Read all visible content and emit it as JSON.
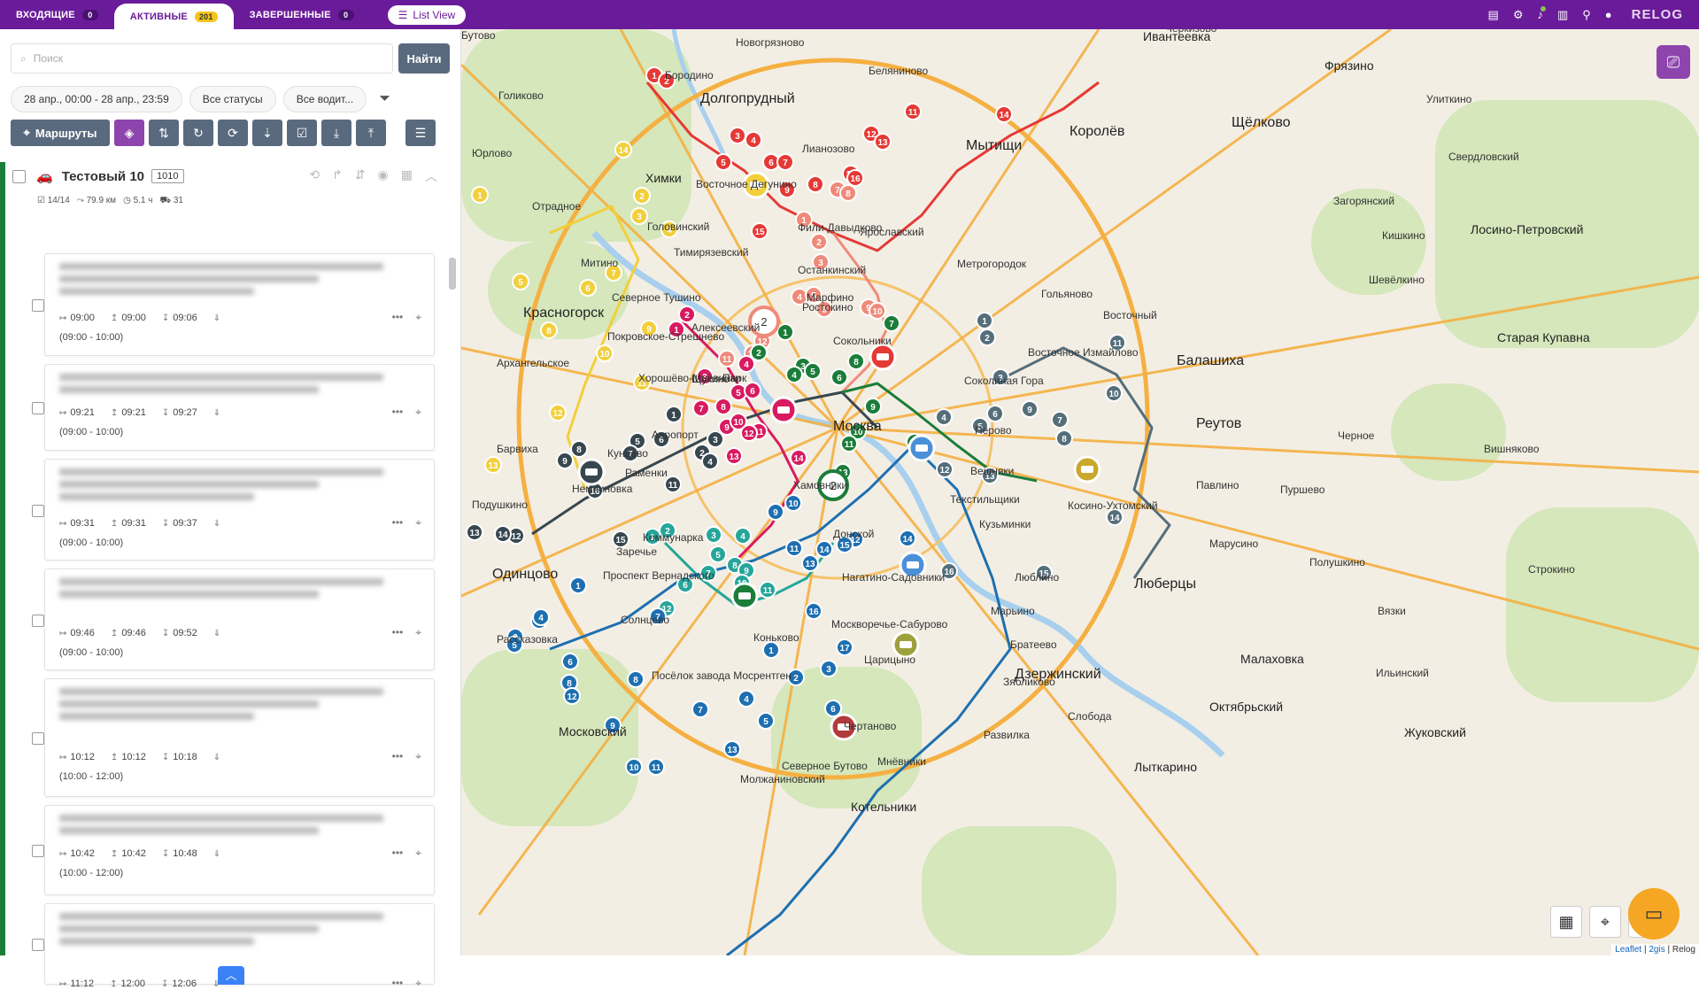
{
  "tabs": [
    {
      "label": "ВХОДЯЩИЕ",
      "count": "0"
    },
    {
      "label": "АКТИВНЫЕ",
      "count": "201"
    },
    {
      "label": "ЗАВЕРШЕННЫЕ",
      "count": "0"
    }
  ],
  "list_view_label": "List View",
  "brand": "RELOG",
  "search": {
    "placeholder": "Поиск",
    "button": "Найти"
  },
  "filters": {
    "date": "28 апр., 00:00 - 28 апр., 23:59",
    "status": "Все статусы",
    "driver": "Все водит..."
  },
  "toolbar": {
    "routes_label": "Маршруты"
  },
  "route": {
    "name": "Тестовый 10",
    "code": "1010",
    "stats": {
      "stops": "14/14",
      "distance": "79.9 км",
      "duration": "5.1 ч",
      "items": "31"
    },
    "stops": [
      {
        "t1": "09:00",
        "t2": "09:00",
        "t3": "09:06",
        "window": "(09:00 - 10:00)"
      },
      {
        "t1": "09:21",
        "t2": "09:21",
        "t3": "09:27",
        "window": "(09:00 - 10:00)"
      },
      {
        "t1": "09:31",
        "t2": "09:31",
        "t3": "09:37",
        "window": "(09:00 - 10:00)"
      },
      {
        "t1": "09:46",
        "t2": "09:46",
        "t3": "09:52",
        "window": "(09:00 - 10:00)"
      },
      {
        "t1": "10:12",
        "t2": "10:12",
        "t3": "10:18",
        "window": "(10:00 - 12:00)"
      },
      {
        "t1": "10:42",
        "t2": "10:42",
        "t3": "10:48",
        "window": "(10:00 - 12:00)"
      },
      {
        "t1": "11:12",
        "t2": "12:00",
        "t3": "12:06",
        "window": ""
      }
    ]
  },
  "map": {
    "places": [
      {
        "name": "Долгопрудный",
        "cls": "big"
      },
      {
        "name": "Химки",
        "cls": "med"
      },
      {
        "name": "Красногорск",
        "cls": "big"
      },
      {
        "name": "Одинцово",
        "cls": "big"
      },
      {
        "name": "Королёв",
        "cls": "big"
      },
      {
        "name": "Мытищи",
        "cls": "big"
      },
      {
        "name": "Балашиха",
        "cls": "big"
      },
      {
        "name": "Реутов",
        "cls": "big"
      },
      {
        "name": "Люберцы",
        "cls": "big"
      },
      {
        "name": "Дзержинский",
        "cls": "big"
      },
      {
        "name": "Котельники",
        "cls": "med"
      },
      {
        "name": "Москва",
        "cls": "big"
      },
      {
        "name": "Ивантеевка",
        "cls": "med"
      },
      {
        "name": "Фрязино",
        "cls": "med"
      },
      {
        "name": "Щёлково",
        "cls": "big"
      },
      {
        "name": "Старая Купавна",
        "cls": "med"
      },
      {
        "name": "Малаховка",
        "cls": "med"
      },
      {
        "name": "Октябрьский",
        "cls": "med"
      },
      {
        "name": "Лыткарино",
        "cls": "med"
      },
      {
        "name": "Московский",
        "cls": "med"
      },
      {
        "name": "Жуковский",
        "cls": "med"
      },
      {
        "name": "Новогрязново",
        "cls": ""
      },
      {
        "name": "Беляниново",
        "cls": ""
      },
      {
        "name": "Черкизово",
        "cls": ""
      },
      {
        "name": "Голиково",
        "cls": ""
      },
      {
        "name": "Юрлово",
        "cls": ""
      },
      {
        "name": "Отрадное",
        "cls": ""
      },
      {
        "name": "Митино",
        "cls": ""
      },
      {
        "name": "Архангельское",
        "cls": ""
      },
      {
        "name": "Барвиха",
        "cls": ""
      },
      {
        "name": "Подушкино",
        "cls": ""
      },
      {
        "name": "Немчиновка",
        "cls": ""
      },
      {
        "name": "Заречье",
        "cls": ""
      },
      {
        "name": "Рассказовка",
        "cls": ""
      },
      {
        "name": "Кунцево",
        "cls": ""
      },
      {
        "name": "Хамовники",
        "cls": ""
      },
      {
        "name": "Нагатино-Садовники",
        "cls": ""
      },
      {
        "name": "Текстильщики",
        "cls": ""
      },
      {
        "name": "Кузьминки",
        "cls": ""
      },
      {
        "name": "Люблино",
        "cls": ""
      },
      {
        "name": "Марьино",
        "cls": ""
      },
      {
        "name": "Братеево",
        "cls": ""
      },
      {
        "name": "Зябликово",
        "cls": ""
      },
      {
        "name": "Чертаново",
        "cls": ""
      },
      {
        "name": "Северное Бутово",
        "cls": ""
      },
      {
        "name": "Развилка",
        "cls": ""
      },
      {
        "name": "Слобода",
        "cls": ""
      },
      {
        "name": "Павлино",
        "cls": ""
      },
      {
        "name": "Пуршево",
        "cls": ""
      },
      {
        "name": "Марусино",
        "cls": ""
      },
      {
        "name": "Полушкино",
        "cls": ""
      },
      {
        "name": "Вязки",
        "cls": ""
      },
      {
        "name": "Ильинский",
        "cls": ""
      },
      {
        "name": "Черное",
        "cls": ""
      },
      {
        "name": "Улиткино",
        "cls": ""
      },
      {
        "name": "Свердловский",
        "cls": ""
      },
      {
        "name": "Загорянский",
        "cls": ""
      },
      {
        "name": "Кишкино",
        "cls": ""
      },
      {
        "name": "Шевёлкино",
        "cls": ""
      },
      {
        "name": "Лосино-Петровский",
        "cls": "med"
      },
      {
        "name": "Вишняково",
        "cls": ""
      },
      {
        "name": "Строкино",
        "cls": ""
      },
      {
        "name": "Восточный",
        "cls": ""
      },
      {
        "name": "Гольяново",
        "cls": ""
      },
      {
        "name": "Метрогородок",
        "cls": ""
      },
      {
        "name": "Ярославский",
        "cls": ""
      },
      {
        "name": "Марфино",
        "cls": ""
      },
      {
        "name": "Тимирязевский",
        "cls": ""
      },
      {
        "name": "Головинский",
        "cls": ""
      },
      {
        "name": "Северное Тушино",
        "cls": ""
      },
      {
        "name": "Покровское-Стрешнево",
        "cls": ""
      },
      {
        "name": "Щукино",
        "cls": ""
      },
      {
        "name": "Хорошёво-Мнёвники",
        "cls": ""
      },
      {
        "name": "Восточное Дегунино",
        "cls": ""
      },
      {
        "name": "Проспект Вернадского",
        "cls": ""
      },
      {
        "name": "Коньково",
        "cls": ""
      },
      {
        "name": "Солнцево",
        "cls": ""
      },
      {
        "name": "Посёлок завода Мосрентген",
        "cls": ""
      },
      {
        "name": "Донской",
        "cls": ""
      },
      {
        "name": "Москворечье-Сабурово",
        "cls": ""
      },
      {
        "name": "Царицыно",
        "cls": ""
      },
      {
        "name": "Сокольники",
        "cls": ""
      },
      {
        "name": "Соколиная Гора",
        "cls": ""
      },
      {
        "name": "Перово",
        "cls": ""
      },
      {
        "name": "Вешняки",
        "cls": ""
      },
      {
        "name": "Косино-Ухтомский",
        "cls": ""
      },
      {
        "name": "Восточное Измайлово",
        "cls": ""
      },
      {
        "name": "Лианозово",
        "cls": ""
      },
      {
        "name": "Бородино",
        "cls": ""
      },
      {
        "name": "Молжаниновский",
        "cls": ""
      },
      {
        "name": "Коммунарка",
        "cls": ""
      },
      {
        "name": "Раменки",
        "cls": ""
      },
      {
        "name": "Фили-Давыдково",
        "cls": ""
      },
      {
        "name": "Останкинский",
        "cls": ""
      },
      {
        "name": "Ростокино",
        "cls": ""
      },
      {
        "name": "Алексеевский",
        "cls": ""
      },
      {
        "name": "Аэропорт",
        "cls": ""
      },
      {
        "name": "Парк",
        "cls": ""
      },
      {
        "name": "Мнёвники",
        "cls": ""
      },
      {
        "name": "Бутово",
        "cls": ""
      }
    ],
    "route_colors": {
      "red": "#e53935",
      "salmon": "#ef8a7a",
      "yellow": "#f2cf3b",
      "pink": "#d81b60",
      "dark": "#37474f",
      "green": "#1b7d3a",
      "teal": "#26a69a",
      "blue": "#1e6fb0",
      "steel": "#546e7a"
    },
    "cluster_labels": [
      "2",
      "2"
    ],
    "attribution": {
      "leaflet": "Leaflet",
      "gis": "2gis",
      "relog": "Relog"
    }
  }
}
